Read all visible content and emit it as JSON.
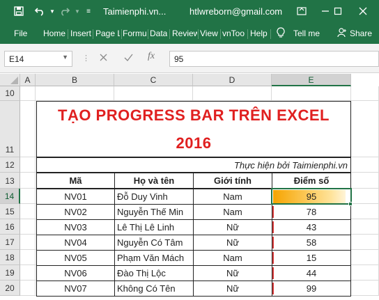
{
  "titlebar": {
    "doc_name": "Taimienphi.vn...",
    "account": "htlwreborn@gmail.com"
  },
  "ribbon": {
    "tabs": [
      "File",
      "Home",
      "Insert",
      "Page L",
      "Formu",
      "Data",
      "Review",
      "View",
      "vnToo",
      "Help"
    ],
    "tell_me": "Tell me",
    "share": "Share"
  },
  "formula_bar": {
    "name_box": "E14",
    "fx": "fx",
    "value": "95"
  },
  "grid": {
    "columns": [
      "A",
      "B",
      "C",
      "D",
      "E"
    ],
    "row_numbers": [
      "10",
      "11",
      "12",
      "13",
      "14",
      "15",
      "16",
      "17",
      "18",
      "19",
      "20"
    ],
    "title_line1": "TẠO PROGRESS BAR TRÊN EXCEL",
    "title_line2": "2016",
    "credit": "Thực hiện bởi Taimienphi.vn",
    "headers": [
      "Mã",
      "Họ và tên",
      "Giới tính",
      "Điểm số"
    ],
    "rows": [
      {
        "ma": "NV01",
        "name": "Đỗ Duy Vinh",
        "gender": "Nam",
        "score": 95
      },
      {
        "ma": "NV02",
        "name": "Nguyễn Thế Min",
        "gender": "Nam",
        "score": 78
      },
      {
        "ma": "NV03",
        "name": "Lê Thị Lê Linh",
        "gender": "Nữ",
        "score": 43
      },
      {
        "ma": "NV04",
        "name": "Nguyễn Có  Tâm",
        "gender": "Nữ",
        "score": 58
      },
      {
        "ma": "NV05",
        "name": "Phạm Văn Mách",
        "gender": "Nam",
        "score": 15
      },
      {
        "ma": "NV06",
        "name": "Đào Thị Lộc",
        "gender": "Nữ",
        "score": 44
      },
      {
        "ma": "NV07",
        "name": "Không Có Tên",
        "gender": "Nữ",
        "score": 99
      }
    ]
  },
  "colors": {
    "excel_green": "#217346",
    "title_red": "#e02020",
    "bar_gold": "#f6a400"
  }
}
